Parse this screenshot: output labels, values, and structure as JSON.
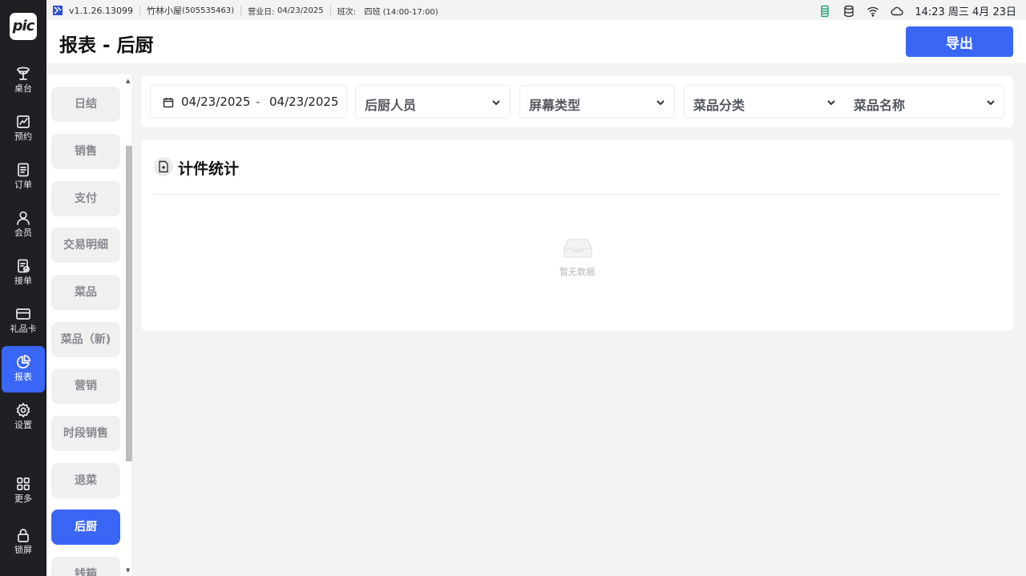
{
  "status_bar": {
    "version": "v1.1.26.13099",
    "store": "竹林小屋",
    "store_id": "(505535463)",
    "business_day_label": "营业日:",
    "business_day": "04/23/2025",
    "shift_label": "班次:",
    "shift": "四班 (14:00-17:00)",
    "clock": "14:23 周三 4月 23日"
  },
  "logo_text": "pic",
  "nav": [
    {
      "label": "桌台",
      "icon": "table-icon"
    },
    {
      "label": "预约",
      "icon": "reservation-icon"
    },
    {
      "label": "订单",
      "icon": "order-icon"
    },
    {
      "label": "会员",
      "icon": "member-icon"
    },
    {
      "label": "接单",
      "icon": "accept-order-icon"
    },
    {
      "label": "礼品卡",
      "icon": "gift-card-icon"
    },
    {
      "label": "报表",
      "icon": "report-icon",
      "active": true
    },
    {
      "label": "设置",
      "icon": "settings-icon"
    },
    {
      "label": "更多",
      "icon": "more-icon"
    },
    {
      "label": "锁屏",
      "icon": "lock-icon"
    }
  ],
  "header": {
    "title": "报表 - 后厨",
    "export_label": "导出"
  },
  "report_menu": [
    {
      "label": "日结"
    },
    {
      "label": "销售"
    },
    {
      "label": "支付"
    },
    {
      "label": "交易明细"
    },
    {
      "label": "菜品"
    },
    {
      "label": "菜品（新)"
    },
    {
      "label": "营销"
    },
    {
      "label": "时段销售"
    },
    {
      "label": "退菜"
    },
    {
      "label": "后厨",
      "active": true
    },
    {
      "label": "钱箱"
    }
  ],
  "filters": {
    "date_start": "04/23/2025",
    "date_sep": "-",
    "date_end": "04/23/2025",
    "chef": "后厨人员",
    "screen_type": "屏幕类型",
    "dish_category": "菜品分类",
    "dish_name": "菜品名称"
  },
  "card": {
    "title": "计件统计",
    "empty_text": "暂无数据"
  },
  "colors": {
    "accent": "#3a66f5",
    "rail": "#1f2024"
  }
}
